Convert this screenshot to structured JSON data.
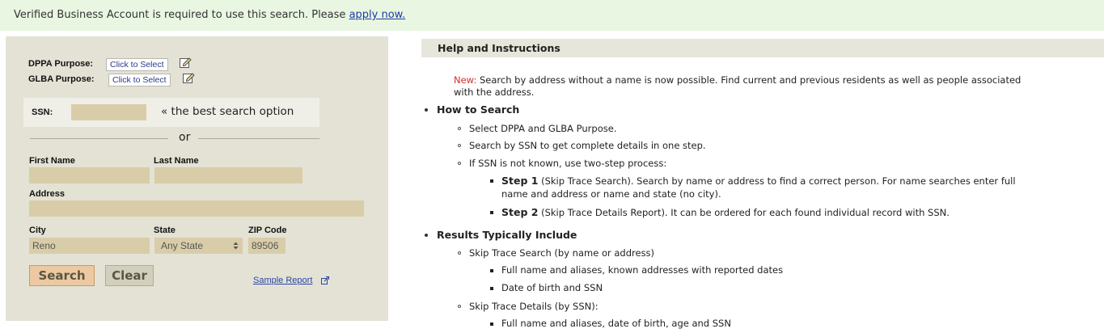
{
  "banner": {
    "text": "Verified Business Account is required to use this search. Please ",
    "link": "apply now."
  },
  "form": {
    "dppa_label": "DPPA Purpose:",
    "dppa_button": "Click to Select",
    "glba_label": "GLBA Purpose:",
    "glba_button": "Click to Select",
    "ssn_label": "SSN:",
    "ssn_value": "",
    "ssn_hint": "« the best search option",
    "or_text": "or",
    "first_name_label": "First Name",
    "first_name_value": "",
    "last_name_label": "Last Name",
    "last_name_value": "",
    "address_label": "Address",
    "address_value": "",
    "city_label": "City",
    "city_value": "Reno",
    "state_label": "State",
    "state_value": "Any State",
    "zip_label": "ZIP Code",
    "zip_value": "89506",
    "search_button": "Search",
    "clear_button": "Clear",
    "sample_report": "Sample Report"
  },
  "help": {
    "title": "Help and Instructions",
    "new_label": "New:",
    "new_text_line1": " Search by address without a name is now possible. Find current and previous residents as well as people associated",
    "new_text_line2": "with the address.",
    "how_title": "How to Search",
    "how_items": [
      "Select DPPA and GLBA Purpose.",
      "Search by SSN to get complete details in one step.",
      "If SSN is not known, use two-step process:"
    ],
    "step1_title": "Step 1",
    "step1_text_line1": " (Skip Trace Search). Search by name or address to find a correct person. For name searches enter full",
    "step1_text_line2": "name and address or name and state (no city).",
    "step2_title": "Step 2",
    "step2_text": " (Skip Trace Details Report). It can be ordered for each found individual record with SSN.",
    "results_title": "Results Typically Include",
    "results_search": "Skip Trace Search (by name or address)",
    "results_search_items": [
      "Full name and aliases, known addresses with reported dates",
      "Date of birth and SSN"
    ],
    "results_details": "Skip Trace Details (by SSN):",
    "results_details_items": [
      "Full name and aliases, date of birth, age and SSN"
    ]
  },
  "colors": {
    "banner_bg": "#e9f6e1",
    "panel_bg": "#e3e2d5",
    "input_tan": "#d9cda9",
    "search_btn": "#ecc9a2",
    "new_red": "#d0312d",
    "link_blue": "#1a3ea8"
  }
}
